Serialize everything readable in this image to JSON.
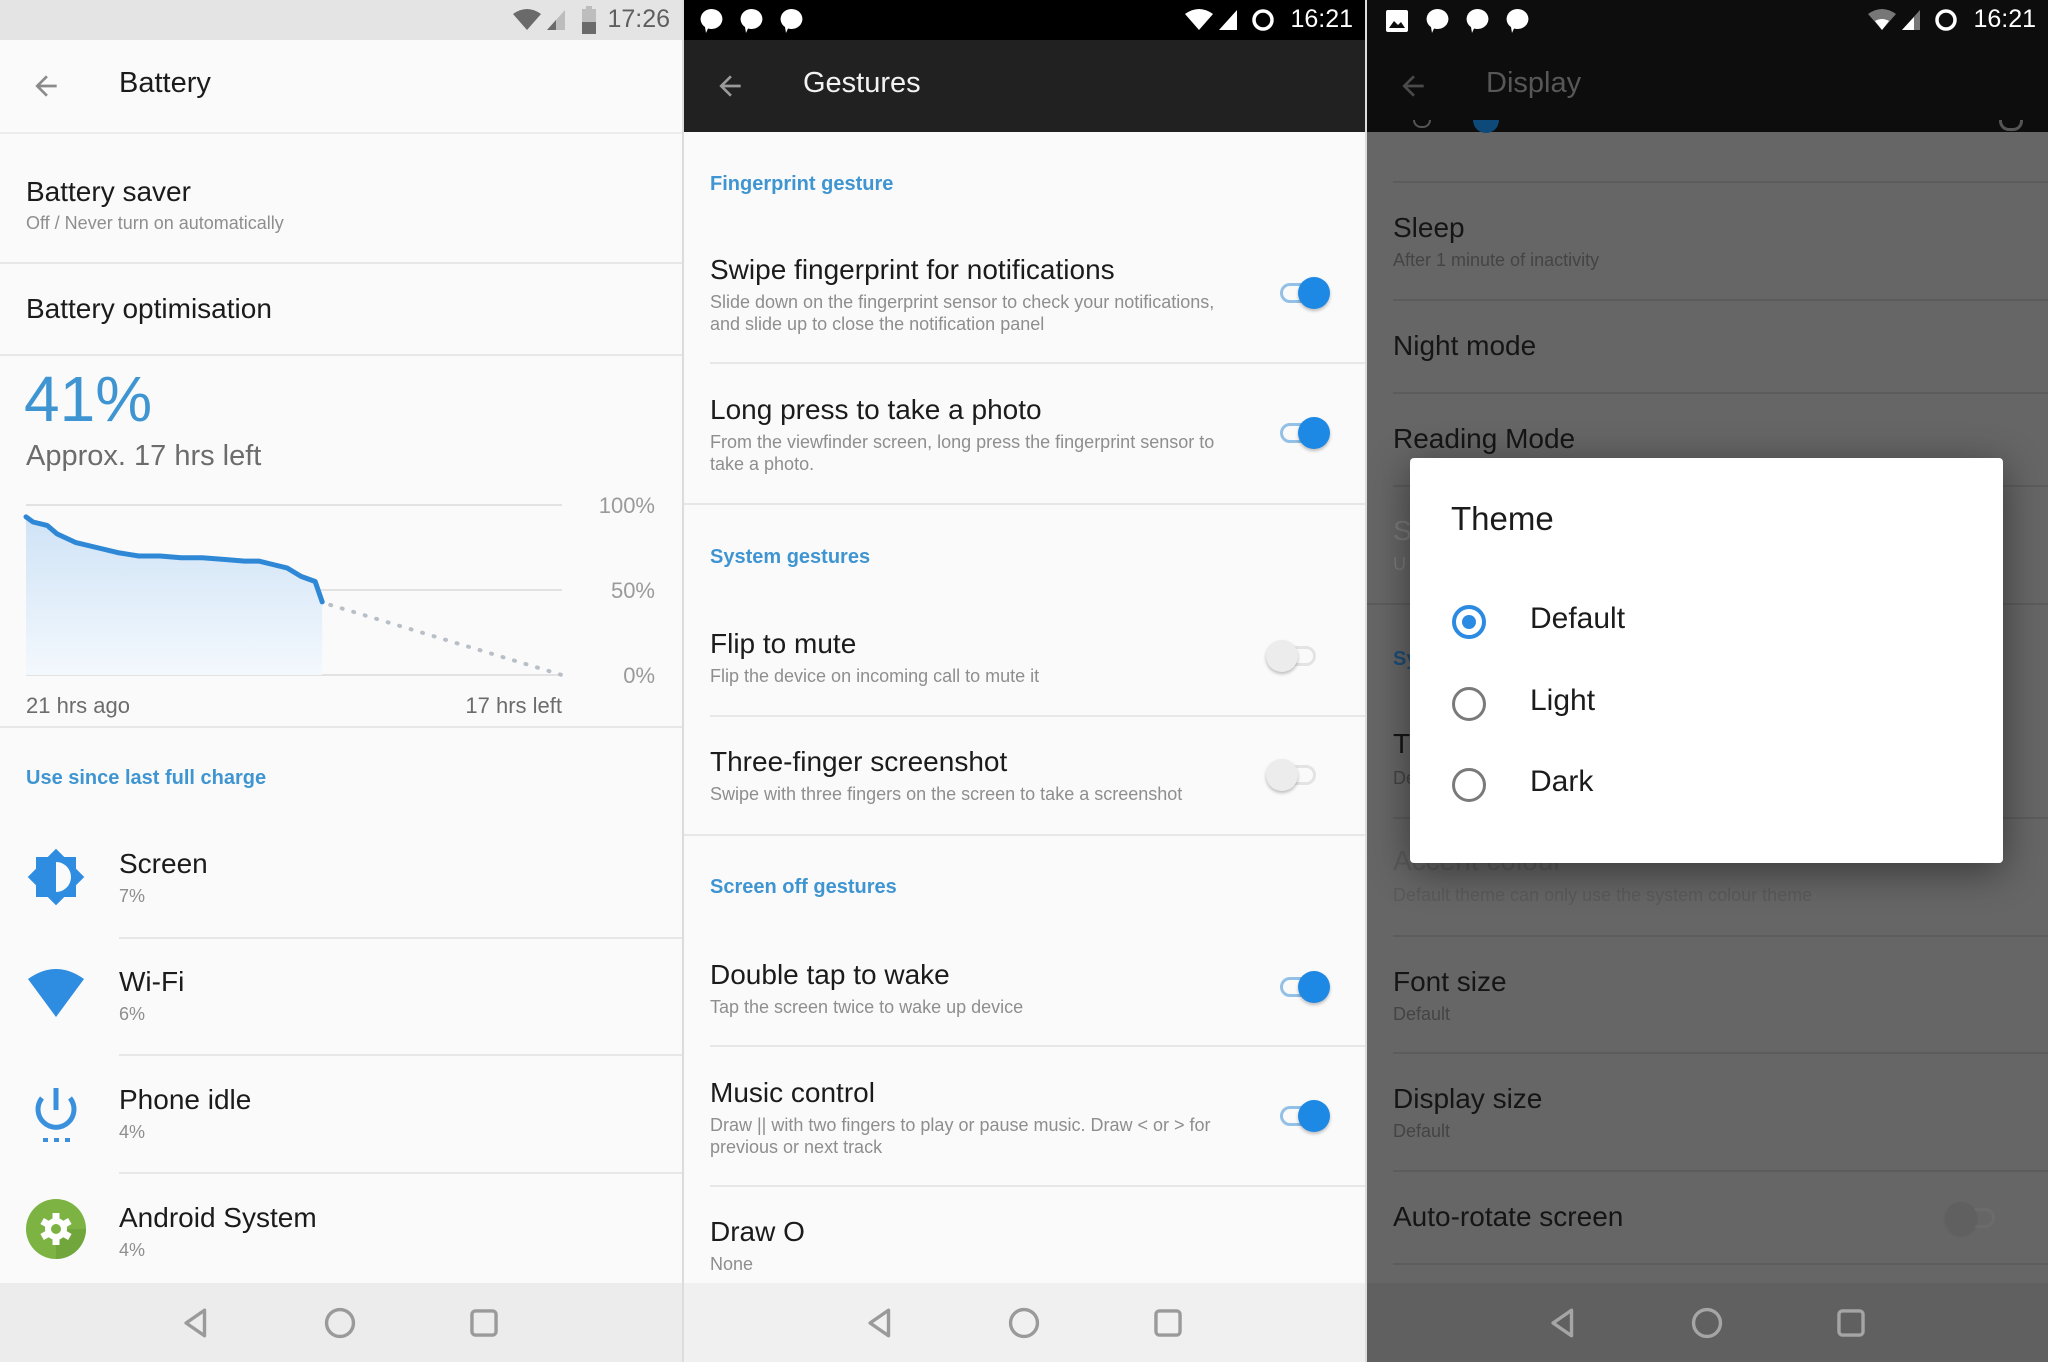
{
  "colors": {
    "accent": "#3f95d1",
    "toggle_on": "#1e88e5",
    "radio_on": "#2b8ae2",
    "android_system_icon": "#7cb342"
  },
  "battery_screen": {
    "status_bar": {
      "time": "17:26",
      "icons": [
        "wifi-icon",
        "cell-signal-icon",
        "battery-icon"
      ]
    },
    "toolbar": {
      "title": "Battery",
      "back_icon": "arrow-back-icon"
    },
    "battery_saver": {
      "title": "Battery saver",
      "subtitle": "Off / Never turn on automatically"
    },
    "battery_optimisation": {
      "title": "Battery optimisation"
    },
    "level": {
      "percent": "41%",
      "estimate": "Approx. 17 hrs left"
    },
    "section_header": "Use since last full charge",
    "usage": [
      {
        "name": "Screen",
        "percent": "7%",
        "icon": "brightness-icon"
      },
      {
        "name": "Wi-Fi",
        "percent": "6%",
        "icon": "wifi-icon"
      },
      {
        "name": "Phone idle",
        "percent": "4%",
        "icon": "power-idle-icon"
      },
      {
        "name": "Android System",
        "percent": "4%",
        "icon": "android-system-gear-icon"
      }
    ]
  },
  "chart_data": {
    "type": "area",
    "title": "",
    "xlabel": "",
    "ylabel": "",
    "x_labels": {
      "start": "21 hrs ago",
      "end": "17 hrs left"
    },
    "y_ticks": [
      "100%",
      "50%",
      "0%"
    ],
    "ylim": [
      0,
      100
    ],
    "xlim_hours": [
      -21,
      17
    ],
    "grid": true,
    "series": [
      {
        "name": "history",
        "style": "solid-filled",
        "x": [
          -21,
          -20.5,
          -19.5,
          -18.8,
          -17.5,
          -16,
          -14.5,
          -13,
          -11.5,
          -10,
          -8.5,
          -7,
          -5.5,
          -4.5,
          -3.5,
          -2.5,
          -1.5,
          -0.5,
          0
        ],
        "y": [
          93,
          90,
          88,
          83,
          78,
          75,
          72,
          70,
          70,
          69,
          69,
          68,
          67,
          67,
          65,
          63,
          58,
          55,
          43
        ]
      },
      {
        "name": "projection",
        "style": "dotted",
        "x": [
          0,
          17
        ],
        "y": [
          43,
          0
        ]
      }
    ]
  },
  "gestures_screen": {
    "status_bar": {
      "time": "16:21",
      "notification_icons": [
        "chat-bubble-icon",
        "chat-bubble-icon",
        "chat-bubble-icon"
      ],
      "icons": [
        "wifi-icon",
        "cell-signal-icon",
        "sync-icon"
      ]
    },
    "toolbar": {
      "title": "Gestures",
      "back_icon": "arrow-back-icon"
    },
    "sections": [
      {
        "header": "Fingerprint gesture",
        "items": [
          {
            "title": "Swipe fingerprint for notifications",
            "subtitle_lines": [
              "Slide down on the fingerprint sensor to check your notifications,",
              "and slide up to close the notification panel"
            ],
            "toggle": true
          },
          {
            "title": "Long press to take a photo",
            "subtitle_lines": [
              "From the viewfinder screen, long press the fingerprint sensor to",
              "take a photo."
            ],
            "toggle": true
          }
        ]
      },
      {
        "header": "System gestures",
        "items": [
          {
            "title": "Flip to mute",
            "subtitle_lines": [
              "Flip the device on incoming call to mute it"
            ],
            "toggle": false
          },
          {
            "title": "Three-finger screenshot",
            "subtitle_lines": [
              "Swipe with three fingers on the screen to take a screenshot"
            ],
            "toggle": false
          }
        ]
      },
      {
        "header": "Screen off gestures",
        "items": [
          {
            "title": "Double tap to wake",
            "subtitle_lines": [
              "Tap the screen twice to wake up device"
            ],
            "toggle": true
          },
          {
            "title": "Music control",
            "subtitle_lines": [
              "Draw || with two fingers to play or pause music. Draw < or > for",
              "previous or next track"
            ],
            "toggle": true
          },
          {
            "title": "Draw O",
            "subtitle_lines": [
              "None"
            ]
          }
        ]
      }
    ]
  },
  "display_screen": {
    "status_bar": {
      "time": "16:21",
      "notification_icons": [
        "image-icon",
        "chat-bubble-icon",
        "chat-bubble-icon",
        "chat-bubble-icon"
      ],
      "icons": [
        "wifi-icon",
        "cell-signal-icon",
        "sync-icon"
      ]
    },
    "toolbar": {
      "title": "Display",
      "back_icon": "arrow-back-icon"
    },
    "items": [
      {
        "title": "Sleep",
        "subtitle": "After 1 minute of inactivity"
      },
      {
        "title": "Night mode"
      },
      {
        "title": "Reading Mode"
      },
      {
        "title": "S",
        "subtitle": "U"
      },
      {
        "header": "Sy"
      },
      {
        "title": "T",
        "subtitle": "De"
      },
      {
        "title": "Accent colour",
        "subtitle": "Default theme can only use the system colour theme"
      },
      {
        "title": "Font size",
        "subtitle": "Default"
      },
      {
        "title": "Display size",
        "subtitle": "Default"
      },
      {
        "title": "Auto-rotate screen",
        "toggle": false
      }
    ],
    "theme_dialog": {
      "title": "Theme",
      "options": [
        {
          "label": "Default",
          "selected": true
        },
        {
          "label": "Light",
          "selected": false
        },
        {
          "label": "Dark",
          "selected": false
        }
      ]
    }
  },
  "nav_bar": {
    "buttons": [
      "back-nav-icon",
      "home-nav-icon",
      "recents-nav-icon"
    ]
  }
}
